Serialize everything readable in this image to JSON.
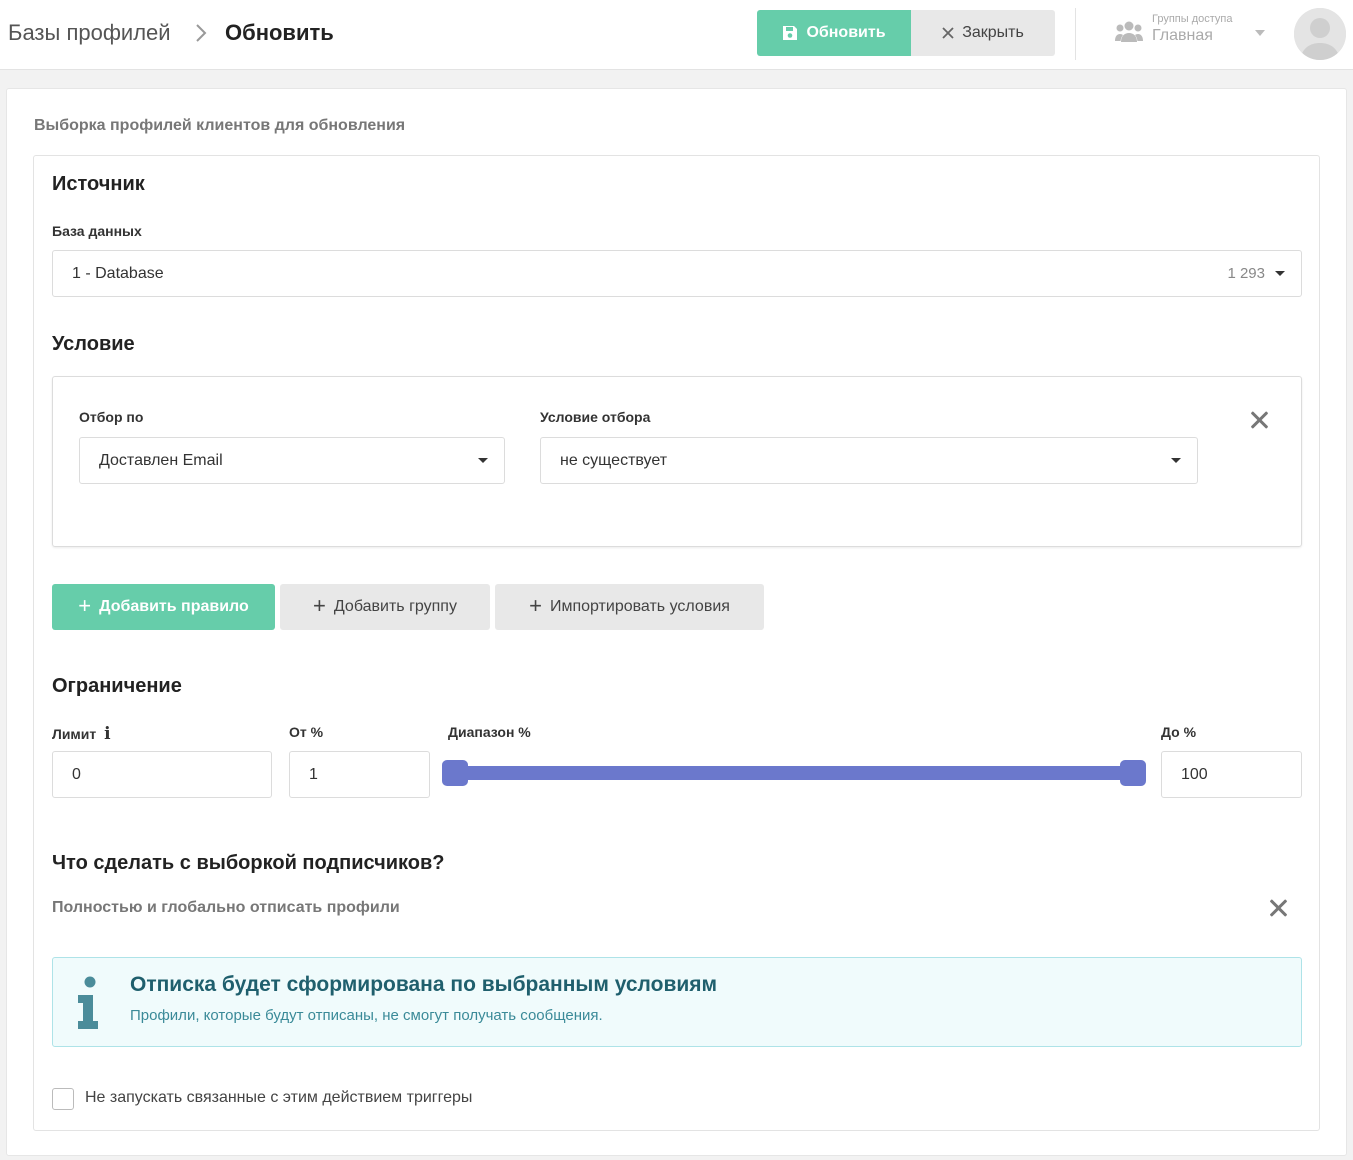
{
  "header": {
    "breadcrumb_root": "Базы профилей",
    "breadcrumb_current": "Обновить",
    "update_label": "Обновить",
    "close_label": "Закрыть",
    "access_caption": "Группы доступа",
    "access_value": "Главная"
  },
  "page": {
    "title": "Выборка профилей клиентов для обновления"
  },
  "source": {
    "heading": "Источник",
    "db_label": "База данных",
    "db_value": "1 - Database",
    "db_count": "1 293"
  },
  "condition": {
    "heading": "Условие",
    "filter_by_label": "Отбор по",
    "filter_by_value": "Доставлен Email",
    "filter_cond_label": "Условие отбора",
    "filter_cond_value": "не существует",
    "add_rule_label": "Добавить правило",
    "add_group_label": "Добавить группу",
    "import_label": "Импортировать условия"
  },
  "limit": {
    "heading": "Ограничение",
    "limit_label": "Лимит",
    "limit_value": "0",
    "from_label": "От %",
    "from_value": "1",
    "range_label": "Диапазон %",
    "to_label": "До %",
    "to_value": "100",
    "range_min": 1,
    "range_max": 100
  },
  "action": {
    "heading": "Что сделать с выборкой подписчиков?",
    "selected": "Полностью и глобально отписать профили",
    "info_title": "Отписка будет сформирована по выбранным условиям",
    "info_text": "Профили, которые будут отписаны, не смогут получать сообщения.",
    "checkbox_label": "Не запускать связанные с этим действием триггеры",
    "checkbox_checked": false
  },
  "colors": {
    "accent_green": "#66cdaa",
    "slider": "#6b78cc",
    "info_bg": "#f0fbfc"
  }
}
